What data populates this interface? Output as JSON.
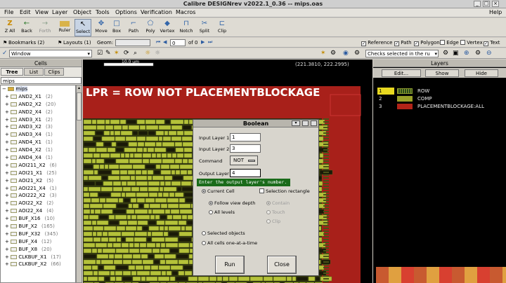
{
  "window": {
    "title": "Calibre DESIGNrev v2022.1_0.36  --  mips.oas",
    "controls": [
      "_",
      "□",
      "×"
    ]
  },
  "menu": {
    "items": [
      "File",
      "Edit",
      "View",
      "Layer",
      "Object",
      "Tools",
      "Options",
      "Verification",
      "Macros"
    ],
    "help": "Help"
  },
  "toolbar": {
    "tools": [
      {
        "label": "Z All",
        "icon": "zoom-all-icon",
        "glyph": "Z"
      },
      {
        "label": "Back",
        "icon": "back-icon",
        "glyph": "←"
      },
      {
        "label": "Forth",
        "icon": "forth-icon",
        "glyph": "→"
      },
      {
        "label": "Ruler",
        "icon": "ruler-icon",
        "glyph": "📏"
      },
      {
        "label": "Select",
        "icon": "select-icon",
        "glyph": "↖"
      },
      {
        "label": "Move",
        "icon": "move-icon",
        "glyph": "✥"
      },
      {
        "label": "Box",
        "icon": "box-icon",
        "glyph": "□"
      },
      {
        "label": "Path",
        "icon": "path-icon",
        "glyph": "⌐"
      },
      {
        "label": "Poly",
        "icon": "poly-icon",
        "glyph": "⬠"
      },
      {
        "label": "Vertex",
        "icon": "vertex-icon",
        "glyph": "◆"
      },
      {
        "label": "Notch",
        "icon": "notch-icon",
        "glyph": "⊓"
      },
      {
        "label": "Split",
        "icon": "split-icon",
        "glyph": "✂"
      },
      {
        "label": "Clip",
        "icon": "clip-icon",
        "glyph": "⊏"
      }
    ]
  },
  "toolbar2": {
    "bookmarks": "Bookmarks (2)",
    "layouts": "Layouts (1)",
    "geom": "Geom:",
    "page": "0",
    "page_of": "of 0",
    "filters": [
      "Reference",
      "Path",
      "Polygon",
      "Edge",
      "Vertex",
      "Text"
    ]
  },
  "toolbar3": {
    "select_mode": "Window",
    "checks_label": "Checks selected in the ru"
  },
  "cells_panel": {
    "title": "Cells",
    "tabs": [
      "Tree",
      "List",
      "Clips"
    ],
    "filter": "mips",
    "top": "mips",
    "items": [
      {
        "name": "AND2_X1",
        "count": "(2)"
      },
      {
        "name": "AND2_X2",
        "count": "(20)"
      },
      {
        "name": "AND2_X4",
        "count": "(2)"
      },
      {
        "name": "AND3_X1",
        "count": "(2)"
      },
      {
        "name": "AND3_X2",
        "count": "(3)"
      },
      {
        "name": "AND3_X4",
        "count": "(1)"
      },
      {
        "name": "AND4_X1",
        "count": "(1)"
      },
      {
        "name": "AND4_X2",
        "count": "(1)"
      },
      {
        "name": "AND4_X4",
        "count": "(1)"
      },
      {
        "name": "AOI211_X2",
        "count": "(6)"
      },
      {
        "name": "AOI21_X1",
        "count": "(25)"
      },
      {
        "name": "AOI21_X2",
        "count": "(5)"
      },
      {
        "name": "AOI221_X4",
        "count": "(1)"
      },
      {
        "name": "AOI222_X2",
        "count": "(3)"
      },
      {
        "name": "AOI22_X2",
        "count": "(2)"
      },
      {
        "name": "AOI22_X4",
        "count": "(4)"
      },
      {
        "name": "BUF_X16",
        "count": "(10)"
      },
      {
        "name": "BUF_X2",
        "count": "(165)"
      },
      {
        "name": "BUF_X32",
        "count": "(345)"
      },
      {
        "name": "BUF_X4",
        "count": "(12)"
      },
      {
        "name": "BUF_X8",
        "count": "(20)"
      },
      {
        "name": "CLKBUF_X1",
        "count": "(17)"
      },
      {
        "name": "CLKBUF_X2",
        "count": "(66)"
      }
    ]
  },
  "canvas": {
    "coords": "(221.3810, 222.2995)",
    "scale": "10.0 um",
    "banner": "LPR = ROW NOT PLACEMENTBLOCKAGE"
  },
  "layers_panel": {
    "title": "Layers",
    "buttons": [
      "Edit...",
      "Show",
      "Hide"
    ],
    "layers": [
      {
        "id": "1",
        "name": "ROW",
        "color": "#8c9a2e"
      },
      {
        "id": "2",
        "name": "COMP",
        "color": "#9aa12a"
      },
      {
        "id": "3",
        "name": "PLACEMENTBLOCKAGE:ALL",
        "color": "#b22418"
      }
    ]
  },
  "boolean_dialog": {
    "title": "Boolean",
    "input1_label": "Input Layer 1",
    "input1_value": "1",
    "input2_label": "Input Layer 2",
    "input2_value": "3",
    "command_label": "Command",
    "command_value": "NOT",
    "output_label": "Output Layer",
    "output_value": "4",
    "tooltip": "Enter the output layer's number.",
    "current_cell": "Current Cell",
    "selection_rect": "Selection rectangle",
    "follow_depth": "Follow view depth",
    "all_levels": "All levels",
    "contain": "Contain",
    "touch": "Touch",
    "clip": "Clip",
    "selected_objects": "Selected objects",
    "all_cells": "All cells one-at-a-time",
    "run": "Run",
    "close": "Close"
  },
  "colors": {
    "row_yellow": "#b5c23a",
    "blockage_red": "#a8201a",
    "tooltip_green": "#1a6b1a"
  }
}
